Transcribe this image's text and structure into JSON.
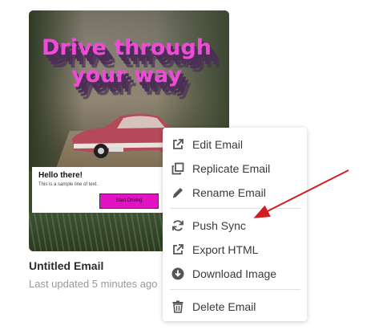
{
  "card": {
    "headline": "Drive through\nyour way",
    "greeting": "Hello there!",
    "sample_text": "This is a sample line of text.",
    "cta_label": "Start Driving",
    "title": "Untitled Email",
    "updated": "Last updated 5 minutes ago"
  },
  "menu": {
    "items": [
      {
        "label": "Edit Email",
        "icon": "external-link-icon"
      },
      {
        "label": "Replicate Email",
        "icon": "copy-icon"
      },
      {
        "label": "Rename Email",
        "icon": "pencil-icon"
      },
      {
        "label": "Push Sync",
        "icon": "sync-icon"
      },
      {
        "label": "Export HTML",
        "icon": "external-link-icon"
      },
      {
        "label": "Download Image",
        "icon": "download-circle-icon"
      },
      {
        "label": "Delete Email",
        "icon": "trash-icon"
      }
    ]
  },
  "colors": {
    "headline_pink": "#f04bd6",
    "cta_magenta": "#e312c4",
    "arrow_red": "#d21e1e",
    "icon_gray": "#555555"
  }
}
